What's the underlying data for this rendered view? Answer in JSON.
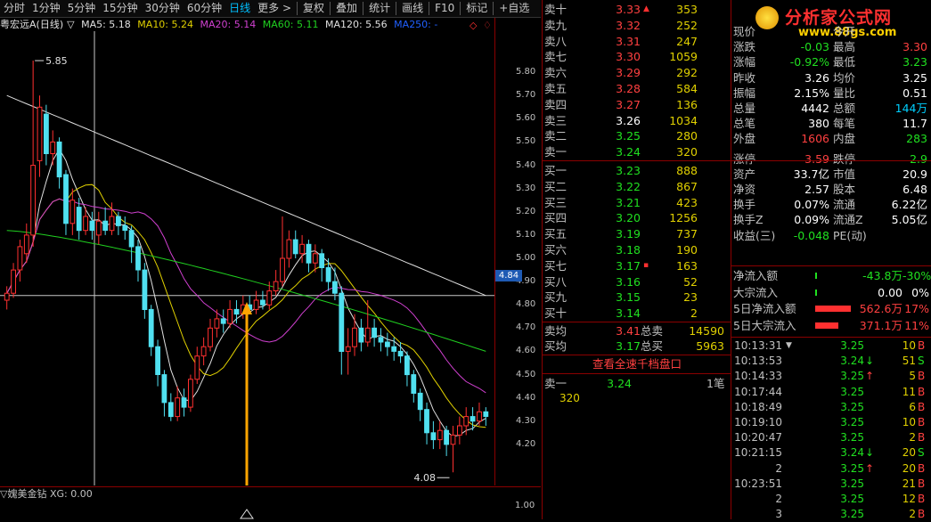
{
  "toolbar": {
    "tabs": [
      {
        "label": "分时",
        "active": false
      },
      {
        "label": "1分钟",
        "active": false
      },
      {
        "label": "5分钟",
        "active": false
      },
      {
        "label": "15分钟",
        "active": false
      },
      {
        "label": "30分钟",
        "active": false
      },
      {
        "label": "60分钟",
        "active": false
      },
      {
        "label": "日线",
        "active": true
      },
      {
        "label": "更多 >",
        "active": false
      }
    ],
    "actions": [
      "复权",
      "叠加",
      "统计",
      "画线",
      "F10",
      "标记",
      "+自选"
    ]
  },
  "ma_bar": {
    "title": "粤宏远A(日线)",
    "marker": "▽",
    "items": [
      {
        "label": "MA5: 5.18",
        "color": "#e0e0e0"
      },
      {
        "label": "MA10: 5.24",
        "color": "#e0d000"
      },
      {
        "label": "MA20: 5.14",
        "color": "#d040d0"
      },
      {
        "label": "MA60: 5.11",
        "color": "#20d020"
      },
      {
        "label": "MA120: 5.56",
        "color": "#e0e0e0"
      },
      {
        "label": "MA250: -",
        "color": "#2060ff"
      }
    ]
  },
  "chart_data": {
    "type": "candlestick",
    "title": "粤宏远A(日线)",
    "y_ticks": [
      "5.80",
      "5.70",
      "5.60",
      "5.50",
      "5.40",
      "5.30",
      "5.20",
      "5.10",
      "5.00",
      "4.90",
      "4.80",
      "4.70",
      "4.60",
      "4.50",
      "4.40",
      "4.30",
      "4.20"
    ],
    "ylim": [
      4.1,
      5.9
    ],
    "high_label": "5.85",
    "low_label": "4.08",
    "current_price": "4.84",
    "candles": [
      [
        4.82,
        4.85,
        4.88,
        4.78
      ],
      [
        4.85,
        4.95,
        4.98,
        4.83
      ],
      [
        4.95,
        5.05,
        5.08,
        4.9
      ],
      [
        5.02,
        5.1,
        5.15,
        4.98
      ],
      [
        5.1,
        5.4,
        5.85,
        5.05
      ],
      [
        5.42,
        5.65,
        5.7,
        5.35
      ],
      [
        5.62,
        5.45,
        5.66,
        5.4
      ],
      [
        5.45,
        5.5,
        5.55,
        5.4
      ],
      [
        5.5,
        5.35,
        5.52,
        5.3
      ],
      [
        5.36,
        5.15,
        5.38,
        5.1
      ],
      [
        5.15,
        5.25,
        5.3,
        5.1
      ],
      [
        5.22,
        5.12,
        5.26,
        5.08
      ],
      [
        5.12,
        5.18,
        5.22,
        5.1
      ],
      [
        5.16,
        5.12,
        5.2,
        5.08
      ],
      [
        5.1,
        5.16,
        5.2,
        5.06
      ],
      [
        5.16,
        5.12,
        5.22,
        5.1
      ],
      [
        5.12,
        5.18,
        5.24,
        5.1
      ],
      [
        5.18,
        5.14,
        5.2,
        5.1
      ],
      [
        5.14,
        5.12,
        5.18,
        5.08
      ],
      [
        5.12,
        5.05,
        5.14,
        4.98
      ],
      [
        5.05,
        4.95,
        5.08,
        4.9
      ],
      [
        4.95,
        4.78,
        4.98,
        4.74
      ],
      [
        4.78,
        4.62,
        4.8,
        4.58
      ],
      [
        4.62,
        4.5,
        4.65,
        4.45
      ],
      [
        4.5,
        4.38,
        4.52,
        4.32
      ],
      [
        4.38,
        4.32,
        4.42,
        4.3
      ],
      [
        4.32,
        4.4,
        4.45,
        4.3
      ],
      [
        4.4,
        4.36,
        4.44,
        4.32
      ],
      [
        4.36,
        4.48,
        4.5,
        4.34
      ],
      [
        4.48,
        4.58,
        4.62,
        4.46
      ],
      [
        4.58,
        4.62,
        4.66,
        4.54
      ],
      [
        4.62,
        4.7,
        4.74,
        4.6
      ],
      [
        4.7,
        4.74,
        4.78,
        4.66
      ],
      [
        4.74,
        4.72,
        4.78,
        4.68
      ],
      [
        4.72,
        4.78,
        4.82,
        4.7
      ],
      [
        4.78,
        4.76,
        4.82,
        4.72
      ],
      [
        4.76,
        4.8,
        4.84,
        4.74
      ],
      [
        4.8,
        4.78,
        4.84,
        4.76
      ],
      [
        4.78,
        4.82,
        4.86,
        4.76
      ],
      [
        4.82,
        4.8,
        4.86,
        4.78
      ],
      [
        4.8,
        4.86,
        4.9,
        4.78
      ],
      [
        4.86,
        4.9,
        4.95,
        4.84
      ],
      [
        4.9,
        5.0,
        5.18,
        4.88
      ],
      [
        5.0,
        5.08,
        5.12,
        4.96
      ],
      [
        5.08,
        5.02,
        5.12,
        5.0
      ],
      [
        5.02,
        5.06,
        5.1,
        4.98
      ],
      [
        5.06,
        4.98,
        5.08,
        4.94
      ],
      [
        4.98,
        5.02,
        5.06,
        4.94
      ],
      [
        5.02,
        4.96,
        5.04,
        4.9
      ],
      [
        4.96,
        4.9,
        5.0,
        4.86
      ],
      [
        4.9,
        4.85,
        4.96,
        4.82
      ],
      [
        4.85,
        4.6,
        4.88,
        4.5
      ],
      [
        4.6,
        4.62,
        4.7,
        4.5
      ],
      [
        4.62,
        4.7,
        4.76,
        4.58
      ],
      [
        4.7,
        4.64,
        4.74,
        4.6
      ],
      [
        4.64,
        4.7,
        4.82,
        4.62
      ],
      [
        4.7,
        4.66,
        4.74,
        4.62
      ],
      [
        4.66,
        4.64,
        4.7,
        4.6
      ],
      [
        4.64,
        4.62,
        4.68,
        4.58
      ],
      [
        4.62,
        4.6,
        4.66,
        4.56
      ],
      [
        4.6,
        4.58,
        4.64,
        4.55
      ],
      [
        4.58,
        4.5,
        4.6,
        4.45
      ],
      [
        4.5,
        4.42,
        4.52,
        4.38
      ],
      [
        4.42,
        4.35,
        4.44,
        4.3
      ],
      [
        4.35,
        4.25,
        4.38,
        4.2
      ],
      [
        4.25,
        4.22,
        4.3,
        4.18
      ],
      [
        4.22,
        4.26,
        4.3,
        4.18
      ],
      [
        4.26,
        4.2,
        4.28,
        4.15
      ],
      [
        4.2,
        4.24,
        4.28,
        4.08
      ],
      [
        4.24,
        4.28,
        4.32,
        4.2
      ],
      [
        4.28,
        4.32,
        4.36,
        4.24
      ],
      [
        4.32,
        4.3,
        4.36,
        4.26
      ],
      [
        4.3,
        4.34,
        4.38,
        4.28
      ],
      [
        4.34,
        4.32,
        4.36,
        4.28
      ]
    ]
  },
  "sub_chart": {
    "title": "▽媿美金钻 XG: 0.00",
    "y_tick": "1.00"
  },
  "orderbook": {
    "asks": [
      {
        "name": "卖十",
        "price": "3.33",
        "vol": "353",
        "flag": "▲"
      },
      {
        "name": "卖九",
        "price": "3.32",
        "vol": "252",
        "flag": ""
      },
      {
        "name": "卖八",
        "price": "3.31",
        "vol": "247",
        "flag": ""
      },
      {
        "name": "卖七",
        "price": "3.30",
        "vol": "1059",
        "flag": ""
      },
      {
        "name": "卖六",
        "price": "3.29",
        "vol": "292",
        "flag": ""
      },
      {
        "name": "卖五",
        "price": "3.28",
        "vol": "584",
        "flag": ""
      },
      {
        "name": "卖四",
        "price": "3.27",
        "vol": "136",
        "flag": ""
      },
      {
        "name": "卖三",
        "price": "3.26",
        "vol": "1034",
        "flag": ""
      },
      {
        "name": "卖二",
        "price": "3.25",
        "vol": "280",
        "flag": ""
      },
      {
        "name": "卖一",
        "price": "3.24",
        "vol": "320",
        "flag": ""
      }
    ],
    "bids": [
      {
        "name": "买一",
        "price": "3.23",
        "vol": "888",
        "flag": ""
      },
      {
        "name": "买二",
        "price": "3.22",
        "vol": "867",
        "flag": ""
      },
      {
        "name": "买三",
        "price": "3.21",
        "vol": "423",
        "flag": ""
      },
      {
        "name": "买四",
        "price": "3.20",
        "vol": "1256",
        "flag": ""
      },
      {
        "name": "买五",
        "price": "3.19",
        "vol": "737",
        "flag": ""
      },
      {
        "name": "买六",
        "price": "3.18",
        "vol": "190",
        "flag": ""
      },
      {
        "name": "买七",
        "price": "3.17",
        "vol": "163",
        "flag": "▪"
      },
      {
        "name": "买八",
        "price": "3.16",
        "vol": "52",
        "flag": ""
      },
      {
        "name": "买九",
        "price": "3.15",
        "vol": "23",
        "flag": ""
      },
      {
        "name": "买十",
        "price": "3.14",
        "vol": "2",
        "flag": ""
      }
    ],
    "summary": [
      {
        "name": "卖均",
        "price": "3.41",
        "label": "总卖",
        "value": "14590"
      },
      {
        "name": "买均",
        "price": "3.17",
        "label": "总买",
        "value": "5963"
      }
    ],
    "full_button": "查看全速千档盘口",
    "queue": {
      "name": "卖一",
      "price": "3.24",
      "count": "1笔",
      "vol": "320"
    }
  },
  "logo": {
    "text": "分析家公式网",
    "url": "www.88gs.com",
    "watermark": "WWW.88GS.COM"
  },
  "quote": {
    "rows": [
      {
        "l1": "现价",
        "v1": "",
        "l2": "今开",
        "v2": ""
      },
      {
        "l1": "涨跌",
        "v1": "-0.03",
        "l2": "最高",
        "v2": "3.30"
      },
      {
        "l1": "涨幅",
        "v1": "-0.92%",
        "l2": "最低",
        "v2": "3.23"
      },
      {
        "l1": "昨收",
        "v1": "3.26",
        "l2": "均价",
        "v2": "3.25"
      },
      {
        "l1": "振幅",
        "v1": "2.15%",
        "l2": "量比",
        "v2": "0.51"
      },
      {
        "l1": "总量",
        "v1": "4442",
        "l2": "总额",
        "v2": "144万"
      },
      {
        "l1": "总笔",
        "v1": "380",
        "l2": "每笔",
        "v2": "11.7"
      },
      {
        "l1": "外盘",
        "v1": "1606",
        "l2": "内盘",
        "v2": "283"
      },
      {
        "l1": "涨停",
        "v1": "3.59",
        "l2": "跌停",
        "v2": "2.9"
      },
      {
        "l1": "资产",
        "v1": "33.7亿",
        "l2": "市值",
        "v2": "20.9"
      },
      {
        "l1": "净资",
        "v1": "2.57",
        "l2": "股本",
        "v2": "6.48"
      },
      {
        "l1": "换手",
        "v1": "0.07%",
        "l2": "流通",
        "v2": "6.22亿"
      },
      {
        "l1": "换手Z",
        "v1": "0.09%",
        "l2": "流通Z",
        "v2": "5.05亿"
      },
      {
        "l1": "收益(三)",
        "v1": "-0.048",
        "l2": "PE(动)",
        "v2": ""
      }
    ],
    "flow": [
      {
        "label": "净流入额",
        "value": "-43.8万",
        "pct": "-30%"
      },
      {
        "label": "大宗流入",
        "value": "0.00",
        "pct": "0%"
      },
      {
        "label": "5日净流入额",
        "value": "562.6万",
        "pct": "17%"
      },
      {
        "label": "5日大宗流入",
        "value": "371.1万",
        "pct": "11%"
      }
    ]
  },
  "ticks": [
    {
      "time": "10:13:31",
      "mark": "▼",
      "price": "3.25",
      "arrow": "",
      "vol": "10",
      "side": "B"
    },
    {
      "time": "10:13:53",
      "mark": "",
      "price": "3.24",
      "arrow": "↓",
      "vol": "51",
      "side": "S"
    },
    {
      "time": "10:14:33",
      "mark": "",
      "price": "3.25",
      "arrow": "↑",
      "vol": "5",
      "side": "B"
    },
    {
      "time": "10:17:44",
      "mark": "",
      "price": "3.25",
      "arrow": "",
      "vol": "11",
      "side": "B"
    },
    {
      "time": "10:18:49",
      "mark": "",
      "price": "3.25",
      "arrow": "",
      "vol": "6",
      "side": "B"
    },
    {
      "time": "10:19:10",
      "mark": "",
      "price": "3.25",
      "arrow": "",
      "vol": "10",
      "side": "B"
    },
    {
      "time": "10:20:47",
      "mark": "",
      "price": "3.25",
      "arrow": "",
      "vol": "2",
      "side": "B"
    },
    {
      "time": "10:21:15",
      "mark": "",
      "price": "3.24",
      "arrow": "↓",
      "vol": "20",
      "side": "S"
    },
    {
      "time": "2",
      "mark": "",
      "price": "3.25",
      "arrow": "↑",
      "vol": "20",
      "side": "B"
    },
    {
      "time": "10:23:51",
      "mark": "",
      "price": "3.25",
      "arrow": "",
      "vol": "21",
      "side": "B"
    },
    {
      "time": "2",
      "mark": "",
      "price": "3.25",
      "arrow": "",
      "vol": "12",
      "side": "B"
    },
    {
      "time": "3",
      "mark": "",
      "price": "3.25",
      "arrow": "",
      "vol": "2",
      "side": "B"
    }
  ]
}
